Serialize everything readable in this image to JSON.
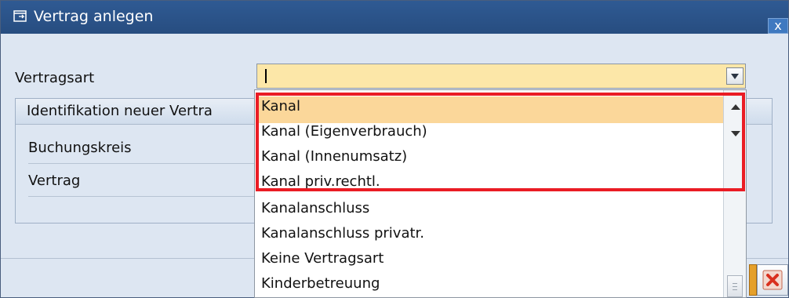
{
  "window": {
    "title": "Vertrag anlegen",
    "close_glyph": "x"
  },
  "form": {
    "vertragsart_label": "Vertragsart",
    "group_title": "Identifikation neuer Vertra",
    "buchungskreis_label": "Buchungskreis",
    "vertrag_label": "Vertrag"
  },
  "dropdown": {
    "selected_index": 0,
    "items": [
      "Kanal",
      "Kanal (Eigenverbrauch)",
      "Kanal (Innenumsatz)",
      "Kanal priv.rechtl.",
      "Kanalanschluss",
      "Kanalanschluss privatr.",
      "Keine Vertragsart",
      "Kinderbetreuung"
    ]
  },
  "colors": {
    "title_bar": "#2f5a93",
    "combo_background": "#fce7a8",
    "selection": "#fbd79a",
    "highlight_border": "#ea1c24",
    "cancel_icon": "#d9301e"
  },
  "icons": {
    "title": "display-window-icon",
    "close": "close-icon",
    "combo": "chevron-down-icon",
    "scroll_up": "scroll-up-icon",
    "scroll_down": "scroll-down-icon",
    "cancel": "cancel-icon"
  }
}
